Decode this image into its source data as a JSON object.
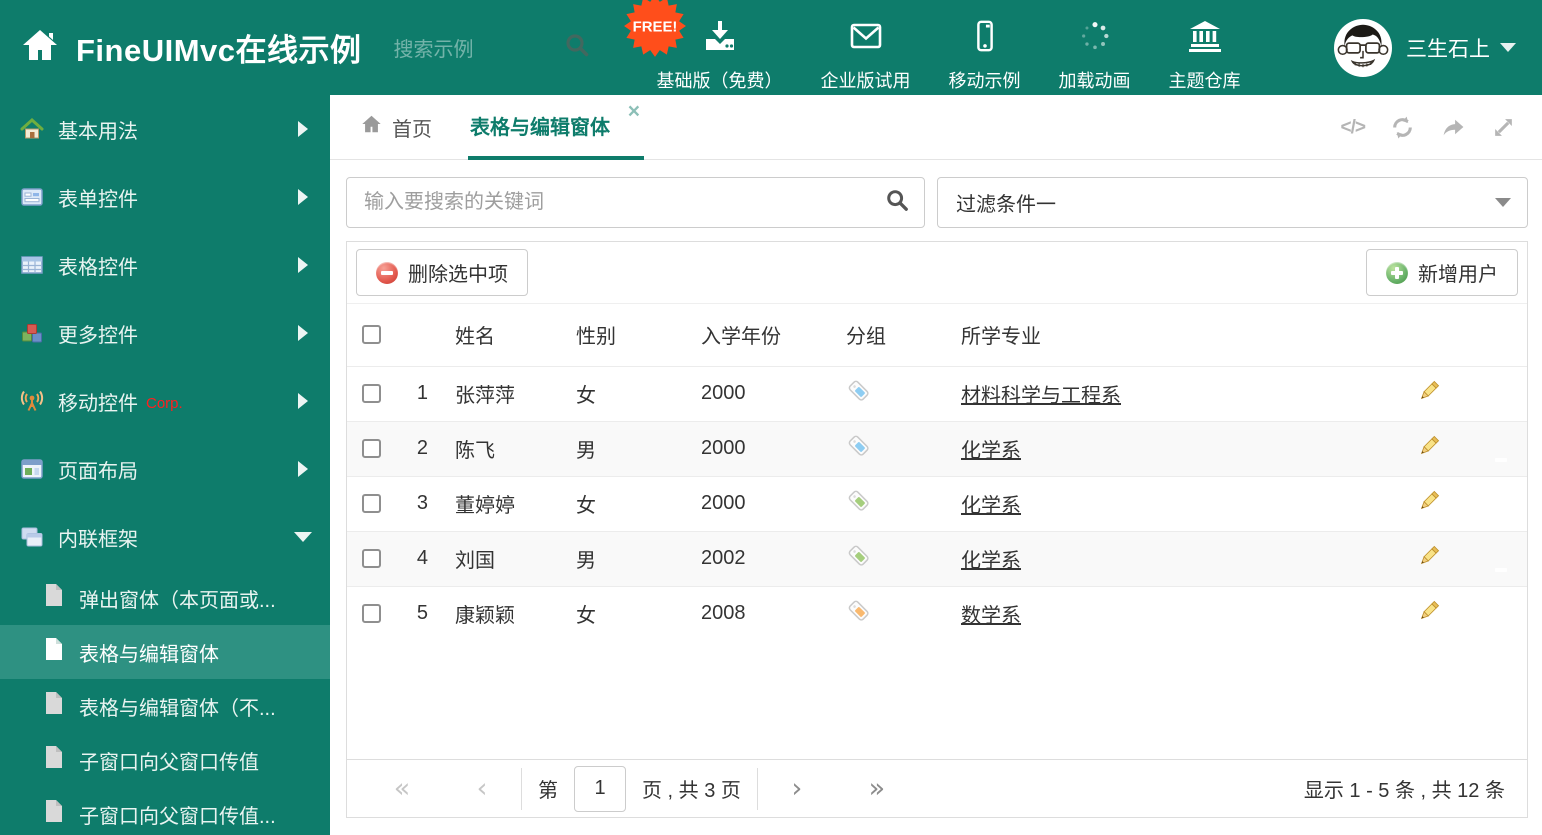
{
  "theme": {
    "teal": "#0E7C6B",
    "teal_selected": "#2E9182",
    "badge_orange": "#FF4E1B",
    "delete_red": "#E2574C",
    "add_green": "#67B168",
    "pencil_yellow": "#F5D76E",
    "tag_blue": "#8ECDF2",
    "tag_green": "#A5CE7D",
    "tag_orange": "#F9B96F"
  },
  "header": {
    "title": "FineUIMvc在线示例",
    "search_placeholder": "搜索示例",
    "free_badge": "FREE!",
    "nav_items": [
      {
        "icon": "download-icon",
        "label": "基础版（免费）"
      },
      {
        "icon": "envelope-icon",
        "label": "企业版试用"
      },
      {
        "icon": "phone-icon",
        "label": "移动示例"
      },
      {
        "icon": "spinner-icon",
        "label": "加载动画"
      },
      {
        "icon": "bank-icon",
        "label": "主题仓库"
      }
    ],
    "user_name": "三生石上"
  },
  "sidebar": {
    "items": [
      {
        "icon": "house-icon",
        "label": "基本用法",
        "arrow": "right"
      },
      {
        "icon": "form-icon",
        "label": "表单控件",
        "arrow": "right"
      },
      {
        "icon": "grid-icon",
        "label": "表格控件",
        "arrow": "right"
      },
      {
        "icon": "cubes-icon",
        "label": "更多控件",
        "arrow": "right"
      },
      {
        "icon": "antenna-icon",
        "label": "移动控件",
        "badge": "Corp.",
        "arrow": "right"
      },
      {
        "icon": "layout-icon",
        "label": "页面布局",
        "arrow": "right"
      },
      {
        "icon": "frames-icon",
        "label": "内联框架",
        "arrow": "down",
        "expanded": true
      }
    ],
    "subitems": [
      {
        "label": "弹出窗体（本页面或...",
        "selected": false
      },
      {
        "label": "表格与编辑窗体",
        "selected": true
      },
      {
        "label": "表格与编辑窗体（不...",
        "selected": false
      },
      {
        "label": "子窗口向父窗口传值",
        "selected": false
      },
      {
        "label": "子窗口向父窗口传值...",
        "selected": false
      }
    ]
  },
  "tabs": {
    "home": "首页",
    "active": "表格与编辑窗体"
  },
  "tab_toolbar_icons": [
    "code-icon",
    "refresh-icon",
    "share-icon",
    "expand-icon"
  ],
  "filter": {
    "keyword_placeholder": "输入要搜索的关键词",
    "selected_filter": "过滤条件一"
  },
  "grid": {
    "delete_button": "删除选中项",
    "add_button": "新增用户",
    "columns": {
      "name": "姓名",
      "gender": "性别",
      "year": "入学年份",
      "group": "分组",
      "major": "所学专业"
    },
    "rows": [
      {
        "num": "1",
        "name": "张萍萍",
        "gender": "女",
        "year": "2000",
        "tag": "blue",
        "major": "材料科学与工程系"
      },
      {
        "num": "2",
        "name": "陈飞",
        "gender": "男",
        "year": "2000",
        "tag": "blue",
        "major": "化学系"
      },
      {
        "num": "3",
        "name": "董婷婷",
        "gender": "女",
        "year": "2000",
        "tag": "green",
        "major": "化学系"
      },
      {
        "num": "4",
        "name": "刘国",
        "gender": "男",
        "year": "2002",
        "tag": "green",
        "major": "化学系"
      },
      {
        "num": "5",
        "name": "康颖颖",
        "gender": "女",
        "year": "2008",
        "tag": "orange",
        "major": "数学系"
      }
    ],
    "pagination": {
      "page_prefix": "第",
      "page": "1",
      "page_suffix": "页 , 共 3 页",
      "summary": "显示 1 - 5 条 , 共 12 条"
    }
  }
}
